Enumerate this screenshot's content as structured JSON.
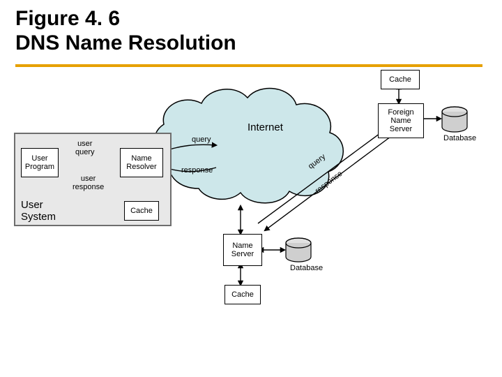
{
  "title_line1": "Figure 4. 6",
  "title_line2": "DNS Name Resolution",
  "labels": {
    "internet": "Internet",
    "user_system": "User\nSystem",
    "user_query": "user\nquery",
    "user_response": "user\nresponse",
    "query_top": "query",
    "response_top": "response",
    "query_diag": "query",
    "response_diag": "response",
    "database_bottom": "Database",
    "database_right": "Database"
  },
  "boxes": {
    "user_program": "User\nProgram",
    "name_resolver": "Name\nResolver",
    "cache_left": "Cache",
    "name_server_bottom": "Name\nServer",
    "cache_bottom": "Cache",
    "foreign_name_server": "Foreign\nName\nServer",
    "cache_top": "Cache"
  }
}
